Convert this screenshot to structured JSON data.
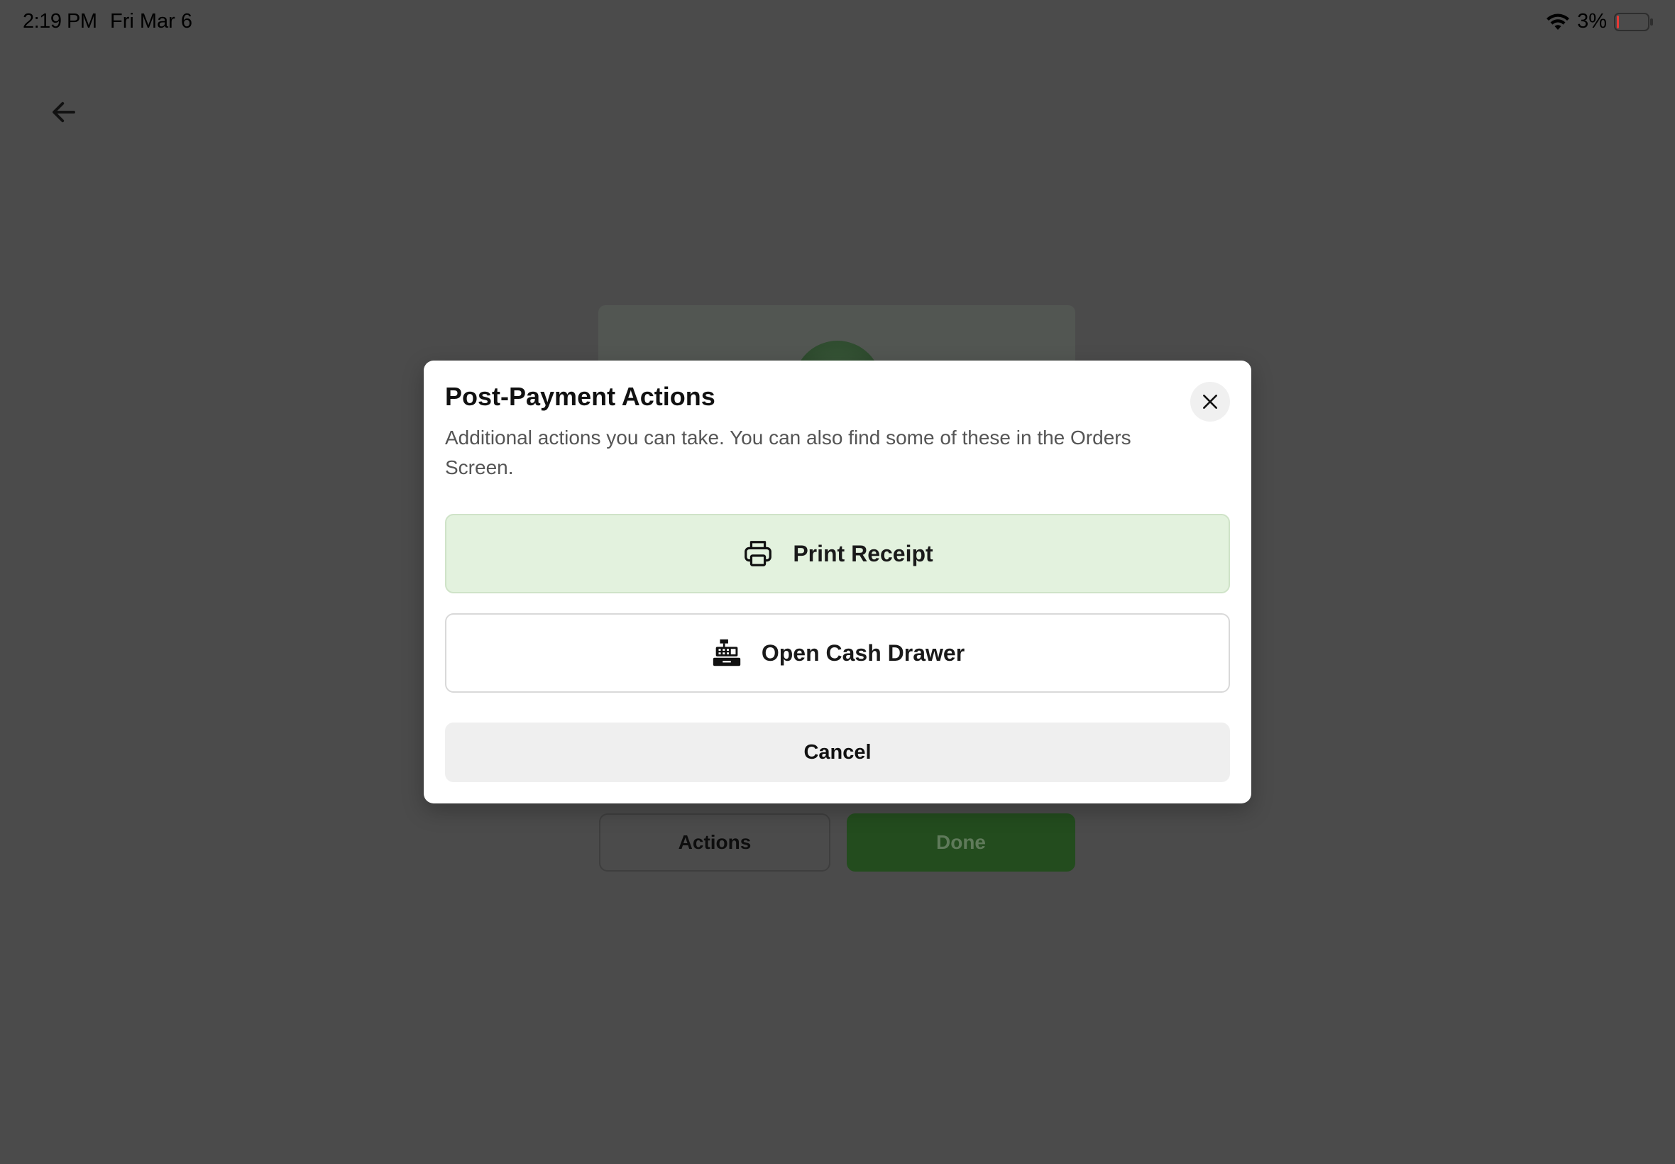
{
  "status_bar": {
    "time": "2:19 PM",
    "date": "Fri Mar 6",
    "battery_percent": "3%",
    "battery_level": 0.03
  },
  "background": {
    "actions_label": "Actions",
    "done_label": "Done"
  },
  "modal": {
    "title": "Post-Payment Actions",
    "description": "Additional actions you can take. You can also find some of these in the Orders Screen.",
    "buttons": [
      {
        "label": "Print Receipt",
        "icon": "printer-icon"
      },
      {
        "label": "Open Cash Drawer",
        "icon": "cash-register-icon"
      }
    ],
    "cancel_label": "Cancel"
  },
  "colors": {
    "overlay_bg": "#4b4b4b",
    "primary_action_bg": "#e3f2de",
    "done_button_bg": "#234c1e",
    "battery_low": "#e53935"
  }
}
